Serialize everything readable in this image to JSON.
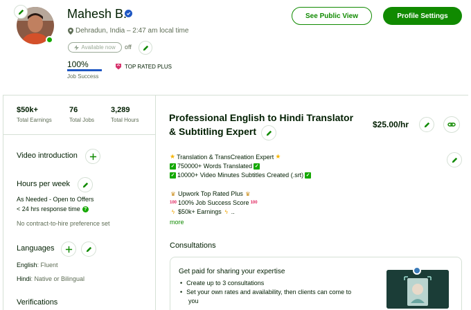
{
  "profile": {
    "name": "Mahesh B.",
    "location": "Dehradun, India – 2:47 am local time",
    "availability_label": "Available now",
    "availability_state": "off",
    "job_success_pct": "100%",
    "job_success_value": 1.0,
    "job_success_label": "Job Success",
    "badge": "TOP RATED PLUS"
  },
  "header_buttons": {
    "public_view": "See Public View",
    "settings": "Profile Settings"
  },
  "stats": [
    {
      "value": "$50k+",
      "label": "Total Earnings"
    },
    {
      "value": "76",
      "label": "Total Jobs"
    },
    {
      "value": "3,289",
      "label": "Total Hours"
    }
  ],
  "left": {
    "video_intro": "Video introduction",
    "hours_title": "Hours per week",
    "hours_line1": "As Needed - Open to Offers",
    "hours_line2": "< 24 hrs response time",
    "contract_pref": "No contract-to-hire preference set",
    "languages_title": "Languages",
    "languages": [
      {
        "name": "English",
        "level": ": Fluent"
      },
      {
        "name": "Hindi",
        "level": ": Native or Bilingual"
      }
    ],
    "verifications_title": "Verifications"
  },
  "main": {
    "title": "Professional English to Hindi Translator & Subtitling Expert",
    "rate": "$25.00/hr",
    "desc": [
      "Translation & TransCreation Expert",
      "750000+ Words Translated",
      "10000+ Video Minutes Subtitles Created (.srt)",
      "Upwork Top Rated Plus",
      "100% Job Success Score",
      "$50k+ Earnings"
    ],
    "more_label": "more",
    "consultations_title": "Consultations",
    "card_title": "Get paid for sharing your expertise",
    "card_bullets": [
      "Create up to 3 consultations",
      "Set your own rates and availability, then clients can come to",
      "you"
    ]
  },
  "colors": {
    "brand_green": "#108a00",
    "text": "#001e00",
    "muted": "#5e6d55",
    "border": "#d5e0d5",
    "blue": "#1f57c3"
  }
}
